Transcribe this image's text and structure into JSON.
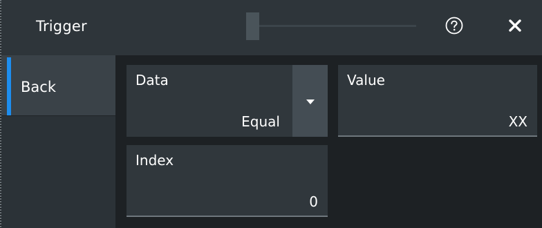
{
  "dialog": {
    "title": "Trigger",
    "help_icon": "question-circle-icon",
    "close_icon": "close-x-icon"
  },
  "sidebar": {
    "items": [
      {
        "label": "Back",
        "selected": true
      }
    ],
    "accent_color": "#1d8ef0"
  },
  "fields": {
    "data": {
      "label": "Data",
      "value": "Equal",
      "has_dropdown": true
    },
    "value": {
      "label": "Value",
      "value": "XX"
    },
    "index": {
      "label": "Index",
      "value": "0"
    }
  }
}
